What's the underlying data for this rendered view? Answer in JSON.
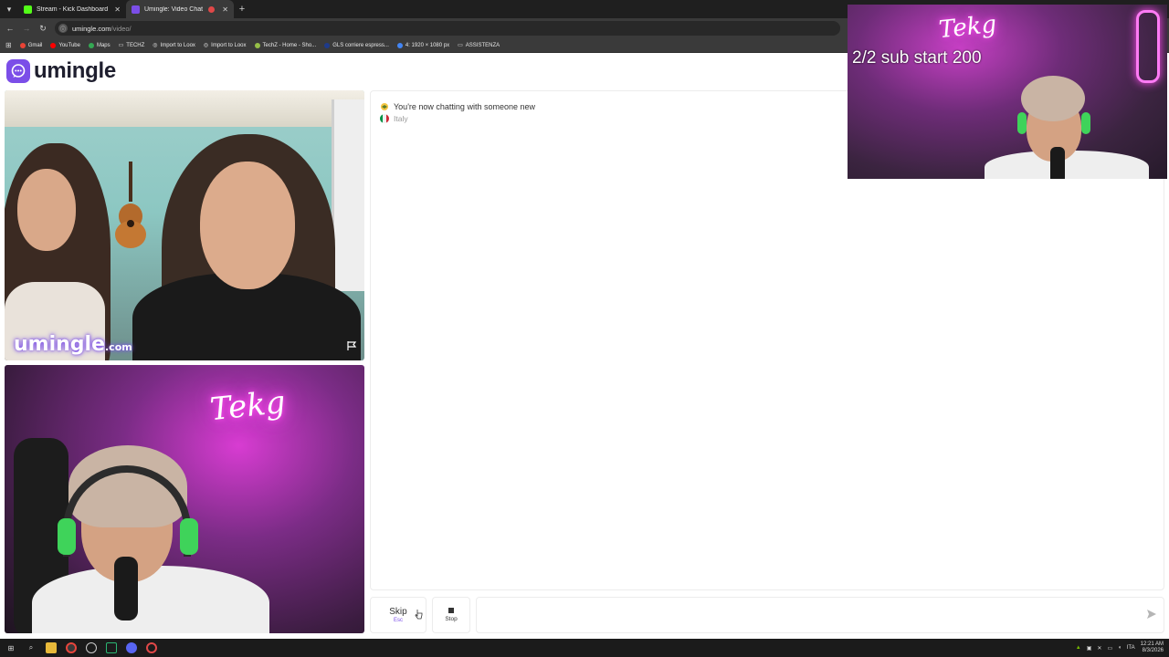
{
  "browser": {
    "tabs": [
      {
        "title": "Stream - Kick Dashboard",
        "active": false,
        "favicon_color": "#53fc18"
      },
      {
        "title": "Umingle: Video Chat with S",
        "active": true,
        "favicon_color": "#7b4ee8"
      }
    ],
    "url": {
      "host": "umingle.com",
      "path": "/video/"
    },
    "bookmarks": [
      {
        "label": "Gmail",
        "icon": "gmail-icon",
        "color": "#ea4335"
      },
      {
        "label": "YouTube",
        "icon": "youtube-icon",
        "color": "#ff0000"
      },
      {
        "label": "Maps",
        "icon": "maps-icon",
        "color": "#34a853"
      },
      {
        "label": "TECHZ",
        "icon": "folder-icon",
        "color": "#cfcfcf"
      },
      {
        "label": "Import to Loox",
        "icon": "globe-icon",
        "color": "#cfcfcf"
      },
      {
        "label": "Import to Loox",
        "icon": "globe-icon",
        "color": "#cfcfcf"
      },
      {
        "label": "TechZ - Home - Sho...",
        "icon": "shopify-icon",
        "color": "#95bf47"
      },
      {
        "label": "GLS corriere espress...",
        "icon": "gls-icon",
        "color": "#1e3a8a"
      },
      {
        "label": "4: 1920 × 1080 px",
        "icon": "image-icon",
        "color": "#4285f4"
      },
      {
        "label": "ASSISTENZA",
        "icon": "folder-icon",
        "color": "#cfcfcf"
      }
    ]
  },
  "site": {
    "logo_text": "umingle",
    "brand_color": "#7b4ee8",
    "watermark_main": "umingle",
    "watermark_suffix": ".com"
  },
  "stranger_video": {
    "neon_sign": ""
  },
  "self_video": {
    "neon_sign": "Tekg"
  },
  "chat": {
    "system_message": "You're now chatting with someone new",
    "country": "Italy"
  },
  "controls": {
    "skip_label": "Skip",
    "skip_key": "Esc",
    "stop_label": "Stop",
    "message_placeholder": ""
  },
  "stream_overlay": {
    "text": "2/2 sub start 200",
    "neon_sign": "Tekg"
  },
  "taskbar": {
    "time": "12:21 AM",
    "date": "8/3/2026",
    "language": "ITA"
  }
}
